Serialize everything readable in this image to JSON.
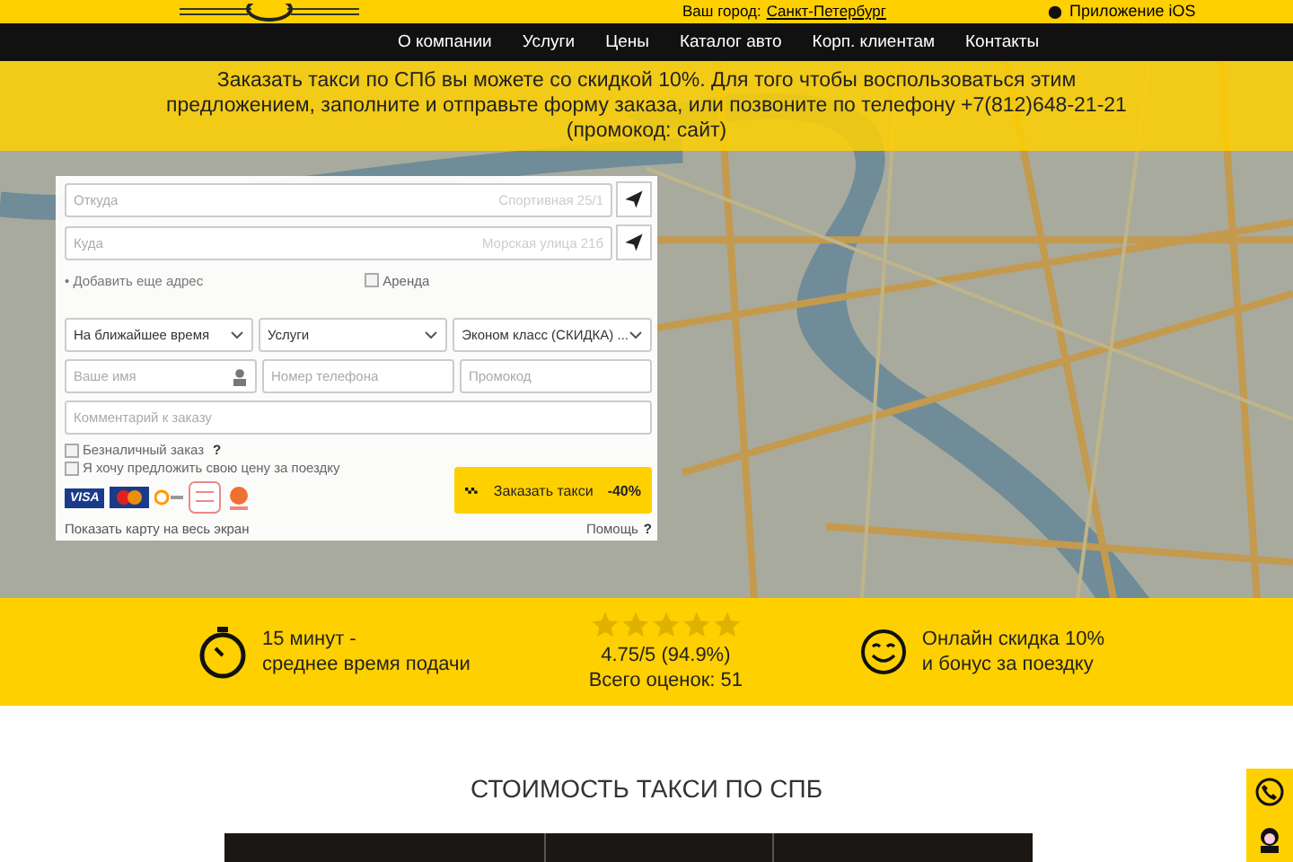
{
  "top_bar": {
    "city_label": "Ваш город:",
    "city": "Санкт-Петербург",
    "app_link": "Приложение iOS"
  },
  "nav": [
    {
      "label": "О компании"
    },
    {
      "label": "Услуги"
    },
    {
      "label": "Цены"
    },
    {
      "label": "Каталог авто"
    },
    {
      "label": "Корп. клиентам"
    },
    {
      "label": "Контакты"
    }
  ],
  "banner": "Заказать такси по СПб вы можете со скидкой 10%. Для того чтобы воспользоваться этим предложением, заполните и отправьте форму заказа, или позвоните по телефону +7(812)648-21-21 (промокод: сайт)",
  "form": {
    "addresses": [
      {
        "placeholder": "Откуда",
        "hint": "Спортивная 25/1"
      },
      {
        "placeholder": "Куда",
        "hint": "Морская улица 21б"
      }
    ],
    "add_address": "• Добавить еще адрес",
    "rent": {
      "label": "Аренда",
      "checked": false
    },
    "selects": [
      {
        "value": "На ближайшее время"
      },
      {
        "value": "Услуги"
      },
      {
        "value": "Эконом класс (СКИДКА) ..."
      }
    ],
    "inputs": [
      {
        "placeholder": "Ваше имя",
        "kind": "name"
      },
      {
        "placeholder": "Номер телефона",
        "kind": "plain"
      },
      {
        "placeholder": "Промокод",
        "kind": "plain"
      }
    ],
    "comment": {
      "placeholder": "Комментарий к заказу"
    },
    "options": [
      {
        "label": "Безналичный заказ",
        "checked": false,
        "help": "?"
      },
      {
        "label": "Я хочу предложить свою цену за поездку",
        "checked": false
      }
    ],
    "visa": "VISA",
    "submit": "Заказать такси **-40%**",
    "fullscreen_link": "Показать карту на весь экран",
    "help_link": "Помощь",
    "help_mark": "?"
  },
  "features": [
    {
      "kind": "time",
      "lines": [
        "15 минут -",
        "среднее время подачи"
      ]
    },
    {
      "kind": "rating",
      "stars": 5,
      "lines": [
        "4.75/5 (94.9%)",
        "Всего оценок: 51"
      ]
    },
    {
      "kind": "bonus",
      "lines": [
        "Онлайн скидка 10%",
        "и бонус за поездку"
      ]
    }
  ],
  "prices_title": "СТОИМОСТЬ ТАКСИ ПО СПБ"
}
